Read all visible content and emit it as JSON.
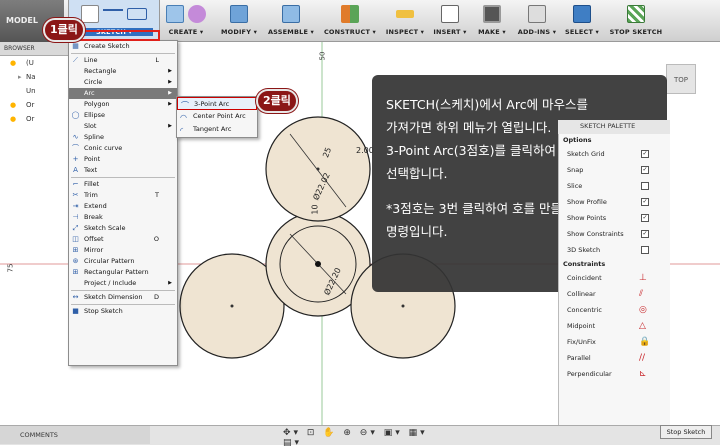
{
  "toolbar": {
    "mode": "MODEL",
    "groups": [
      {
        "label": "SKETCH ▾"
      },
      {
        "label": "CREATE ▾"
      },
      {
        "label": "MODIFY ▾"
      },
      {
        "label": "ASSEMBLE ▾"
      },
      {
        "label": "CONSTRUCT ▾"
      },
      {
        "label": "INSPECT ▾"
      },
      {
        "label": "INSERT ▾"
      },
      {
        "label": "MAKE ▾"
      },
      {
        "label": "ADD-INS ▾"
      },
      {
        "label": "SELECT ▾"
      },
      {
        "label": "STOP SKETCH"
      }
    ]
  },
  "browser": {
    "header": "BROWSER",
    "rows": [
      "(U",
      "Na",
      "Un",
      "Or",
      "Or"
    ]
  },
  "sketch_menu": {
    "items": [
      {
        "label": "Create Sketch",
        "shortcut": "",
        "icon": "create-sketch-icon",
        "glyph": "▦"
      },
      {
        "sep": true
      },
      {
        "label": "Line",
        "shortcut": "L",
        "icon": "line-icon",
        "glyph": "⟋"
      },
      {
        "label": "Rectangle",
        "shortcut": "",
        "arrow": true
      },
      {
        "label": "Circle",
        "shortcut": "",
        "arrow": true
      },
      {
        "label": "Arc",
        "shortcut": "",
        "arrow": true,
        "highlight": true
      },
      {
        "label": "Polygon",
        "shortcut": "",
        "arrow": true
      },
      {
        "label": "Ellipse",
        "shortcut": "",
        "icon": "ellipse-icon",
        "glyph": "◯"
      },
      {
        "label": "Slot",
        "shortcut": "",
        "arrow": true
      },
      {
        "label": "Spline",
        "shortcut": "",
        "icon": "spline-icon",
        "glyph": "∿"
      },
      {
        "label": "Conic curve",
        "shortcut": "",
        "icon": "conic-curve-icon",
        "glyph": "⌒"
      },
      {
        "label": "Point",
        "shortcut": "",
        "icon": "point-icon",
        "glyph": "+"
      },
      {
        "label": "Text",
        "shortcut": "",
        "icon": "text-icon",
        "glyph": "A"
      },
      {
        "sep": true
      },
      {
        "label": "Fillet",
        "shortcut": "",
        "icon": "fillet-icon",
        "glyph": "⌐"
      },
      {
        "label": "Trim",
        "shortcut": "T",
        "icon": "trim-icon",
        "glyph": "✂"
      },
      {
        "label": "Extend",
        "shortcut": "",
        "icon": "extend-icon",
        "glyph": "⇥"
      },
      {
        "label": "Break",
        "shortcut": "",
        "icon": "break-icon",
        "glyph": "⊣"
      },
      {
        "label": "Sketch Scale",
        "shortcut": "",
        "icon": "sketch-scale-icon",
        "glyph": "⤢"
      },
      {
        "label": "Offset",
        "shortcut": "O",
        "icon": "offset-icon",
        "glyph": "◫"
      },
      {
        "label": "Mirror",
        "shortcut": "",
        "icon": "mirror-icon",
        "glyph": "⊞"
      },
      {
        "label": "Circular Pattern",
        "shortcut": "",
        "icon": "circular-pattern-icon",
        "glyph": "⊛"
      },
      {
        "label": "Rectangular Pattern",
        "shortcut": "",
        "icon": "rectangular-pattern-icon",
        "glyph": "⊞"
      },
      {
        "label": "Project / Include",
        "shortcut": "",
        "arrow": true
      },
      {
        "sep": true
      },
      {
        "label": "Sketch Dimension",
        "shortcut": "D",
        "icon": "sketch-dimension-icon",
        "glyph": "↔"
      },
      {
        "sep": true
      },
      {
        "label": "Stop Sketch",
        "shortcut": "",
        "icon": "stop-sketch-icon",
        "glyph": "■"
      }
    ]
  },
  "arc_submenu": {
    "items": [
      {
        "label": "3-Point Arc",
        "glyph": "⌒",
        "highlight": true
      },
      {
        "label": "Center Point Arc",
        "glyph": "◠"
      },
      {
        "label": "Tangent Arc",
        "glyph": "◜"
      }
    ]
  },
  "badges": {
    "step1": "1클릭",
    "step2": "2클릭"
  },
  "callout": {
    "lines": [
      "SKETCH(스케치)에서 Arc에 마우스를",
      "가져가면 하위 메뉴가 열립니다.",
      "3-Point Arc(3점호)를 클릭하여",
      "선택합니다.",
      "",
      "*3점호는 3번 클릭하여 호를 만들 수 있는",
      "명령입니다."
    ]
  },
  "canvas": {
    "axis_top": "50",
    "axis_left": "75",
    "dims": [
      "25",
      "Ø22.02",
      "Ø22.20",
      "2.00",
      "10"
    ],
    "view_cube": "TOP"
  },
  "palette": {
    "header": "SKETCH PALETTE",
    "options_title": "Options",
    "options": [
      {
        "label": "Sketch Grid",
        "checked": true
      },
      {
        "label": "Snap",
        "checked": true
      },
      {
        "label": "Slice",
        "checked": false
      },
      {
        "label": "Show Profile",
        "checked": true
      },
      {
        "label": "Show Points",
        "checked": true
      },
      {
        "label": "Show Constraints",
        "checked": true
      },
      {
        "label": "3D Sketch",
        "checked": false
      }
    ],
    "constraints_title": "Constraints",
    "constraints": [
      {
        "label": "Coincident",
        "glyph": "⊥"
      },
      {
        "label": "Collinear",
        "glyph": "⫽"
      },
      {
        "label": "Concentric",
        "glyph": "◎"
      },
      {
        "label": "Midpoint",
        "glyph": "△"
      },
      {
        "label": "Fix/UnFix",
        "glyph": "🔒"
      },
      {
        "label": "Parallel",
        "glyph": "//"
      },
      {
        "label": "Perpendicular",
        "glyph": "⊾"
      }
    ],
    "stop_sketch": "Stop Sketch"
  },
  "bottom": {
    "comments": "COMMENTS",
    "nav": "✥▾ ⊡ ✋ ⊕ ⊖▾ ▣▾ ▦▾ ▤▾"
  },
  "colors": {
    "accent_red": "#e0201a",
    "badge": "#8b1616",
    "callout_bg": "#343434",
    "sketch_fill": "#efe4d2"
  }
}
